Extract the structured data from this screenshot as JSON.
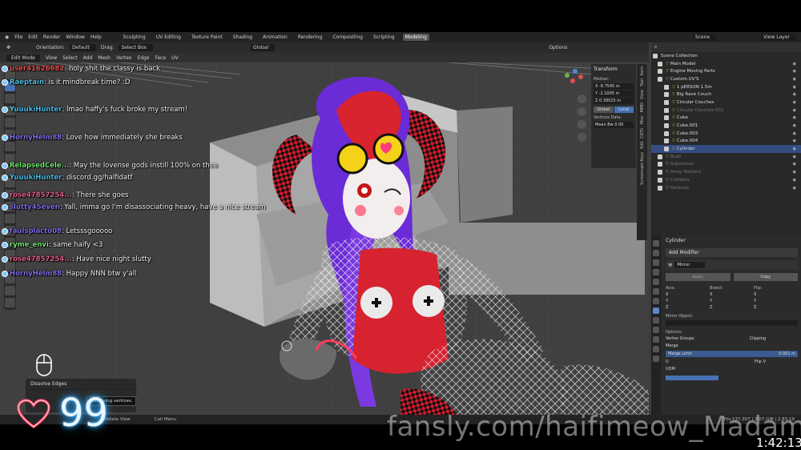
{
  "topbar": {
    "menus": [
      "File",
      "Edit",
      "Render",
      "Window",
      "Help"
    ],
    "workspaces": [
      "Sculpting",
      "UV Editing",
      "Texture Paint",
      "Shading",
      "Animation",
      "Rendering",
      "Compositing",
      "Scripting",
      "Modeling"
    ],
    "active_workspace": "Modeling",
    "scene_label": "Scene",
    "view_layer_label": "View Layer"
  },
  "tool_header": {
    "orientation_label": "Orientation:",
    "orientation_value": "Default",
    "drag_label": "Drag:",
    "drag_value": "Select Box",
    "transform_value": "Global",
    "options_label": "Options"
  },
  "view_header": {
    "mode": "Edit Mode",
    "menus": [
      "View",
      "Select",
      "Add",
      "Mesh",
      "Vertex",
      "Edge",
      "Face",
      "UV"
    ]
  },
  "transform_panel": {
    "title": "Transform",
    "median_label": "Median:",
    "x": "X  -8.7545 m",
    "y": "Y  -2.1005 m",
    "z": "Z  0.38025 m",
    "global": "Global",
    "local": "Local",
    "vertices_label": "Vertices Data:",
    "mean_bw": "Mean Bw  0.00"
  },
  "side_tabs": [
    "Item",
    "Tool",
    "View",
    "MMD",
    "Misc",
    "CATS",
    "Edit",
    "Screencast Keys"
  ],
  "outliner": {
    "title": "Scene Collection",
    "items": [
      {
        "label": "Main Model",
        "dim": false,
        "sel": false
      },
      {
        "label": "Engine Moving Parts",
        "dim": false,
        "sel": false
      },
      {
        "label": "Custom UV'S",
        "dim": false,
        "sel": false
      },
      {
        "label": "1 pERSON 1.5m",
        "dim": false,
        "sel": false
      },
      {
        "label": "Big Rave Couch",
        "dim": false,
        "sel": false
      },
      {
        "label": "Circular Couches",
        "dim": false,
        "sel": false
      },
      {
        "label": "Circular Couches.001",
        "dim": true,
        "sel": false
      },
      {
        "label": "Cube",
        "dim": false,
        "sel": false
      },
      {
        "label": "Cube.001",
        "dim": false,
        "sel": false
      },
      {
        "label": "Cube.003",
        "dim": false,
        "sel": false
      },
      {
        "label": "Cube.004",
        "dim": false,
        "sel": false
      },
      {
        "label": "Cylinder",
        "dim": false,
        "sel": true
      },
      {
        "label": "Bush",
        "dim": true,
        "sel": false
      },
      {
        "label": "Substance",
        "dim": true,
        "sel": false
      },
      {
        "label": "Array Markers",
        "dim": true,
        "sel": false
      },
      {
        "label": "Colliders",
        "dim": true,
        "sel": false
      },
      {
        "label": "Particals",
        "dim": true,
        "sel": false
      }
    ]
  },
  "properties": {
    "object_name": "Cylinder",
    "add_modifier": "Add Modifier",
    "modifier_name": "Mirror",
    "apply": "Apply",
    "copy": "Copy",
    "axis_label": "Axis:",
    "bisect_label": "Bisect:",
    "flip_label": "Flip:",
    "axes": [
      "X",
      "Y",
      "Z"
    ],
    "mirror_object": "Mirror Object:",
    "options_label": "Options:",
    "vertex_groups": "Vertex Groups",
    "clipping": "Clipping",
    "merge": "Merge",
    "merge_limit": "Merge Limit",
    "merge_limit_value": "0.001 m",
    "u_label": "U",
    "flip_v": "Flip V",
    "uom": "UOM"
  },
  "statusbar": {
    "rotate_view": "Rotate View",
    "call_menu": "Call Menu",
    "stats": "Tris:137,307 | 2.07 GiB | 2.83.19"
  },
  "chat": [
    {
      "name": "user41626682",
      "text": ": holy shit the classy is back",
      "color": "#ff5a5a"
    },
    {
      "name": "Raeptain",
      "text": ": is it mindbreak time? :D",
      "color": "#5ad2ff"
    },
    {
      "name": "YuuukiHunter",
      "text": ": lmao haffy's fuck broke my stream!",
      "color": "#5ad2ff"
    },
    {
      "name": "HornyHelm88",
      "text": ": Love how immediately she breaks",
      "color": "#8a7bff"
    },
    {
      "name": "RelapsedCele...",
      "text": ": May the lovense gods instill 100% on thee",
      "color": "#7dff7d"
    },
    {
      "name": "YuuukiHunter",
      "text": ": discord.gg/halfidatf",
      "color": "#5ad2ff"
    },
    {
      "name": "rose47857254...",
      "text": ": There she goes",
      "color": "#ff6b9a"
    },
    {
      "name": "slutty4Seven",
      "text": ": Yall, imma go I'm disassociating heavy, have a nice stream",
      "color": "#8a7bff"
    },
    {
      "name": "faulsplacto08",
      "text": ": Letsssgooooo",
      "color": "#8a7bff"
    },
    {
      "name": "ryme_envi",
      "text": ": same haify <3",
      "color": "#7dff7d"
    },
    {
      "name": "rose47857254...",
      "text": ": Have nice night slutty",
      "color": "#ff6b9a"
    },
    {
      "name": "HornyHelm88",
      "text": ": Happy NNN btw y'all",
      "color": "#8a7bff"
    }
  ],
  "operator_panel": {
    "title": "Dissolve Edges",
    "tooltip": "Dissolving vertices."
  },
  "overlay": {
    "counter": "99",
    "watermark": "fansly.com/haifimeow_Madam",
    "timestamp": "1:42:13"
  },
  "colors": {
    "accent": "#4772b3",
    "counter_glow": "#2aa8ff",
    "heart": "#ff3b5c"
  }
}
